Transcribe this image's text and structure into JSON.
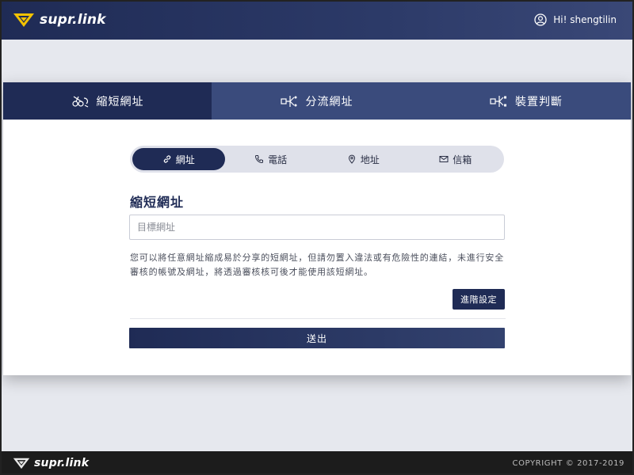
{
  "brand": {
    "name": "supr.link"
  },
  "header": {
    "user_greeting": "Hi! shengtilin"
  },
  "tabs": [
    {
      "label": "縮短網址",
      "icon": "scissors-link-icon",
      "active": true
    },
    {
      "label": "分流網址",
      "icon": "split-route-icon",
      "active": false
    },
    {
      "label": "裝置判斷",
      "icon": "device-route-icon",
      "active": false
    }
  ],
  "segments": [
    {
      "label": "網址",
      "icon": "link-icon",
      "active": true
    },
    {
      "label": "電話",
      "icon": "phone-icon",
      "active": false
    },
    {
      "label": "地址",
      "icon": "map-pin-icon",
      "active": false
    },
    {
      "label": "信箱",
      "icon": "mail-icon",
      "active": false
    }
  ],
  "form": {
    "title": "縮短網址",
    "input_placeholder": "目標網址",
    "input_value": "",
    "description": "您可以將任意網址縮成易於分享的短網址，但請勿置入違法或有危險性的連結，未進行安全審核的帳號及網址，將透過審核核可後才能使用該短網址。",
    "advanced_label": "進階設定",
    "submit_label": "送出"
  },
  "footer": {
    "brand": "supr.link",
    "copyright": "COPYRIGHT © 2017-2019"
  },
  "colors": {
    "navy": "#1f2b55",
    "tab_inactive": "#3a4b7c",
    "logo_yellow": "#f2c200",
    "pill_bg": "#dfe1ea"
  }
}
